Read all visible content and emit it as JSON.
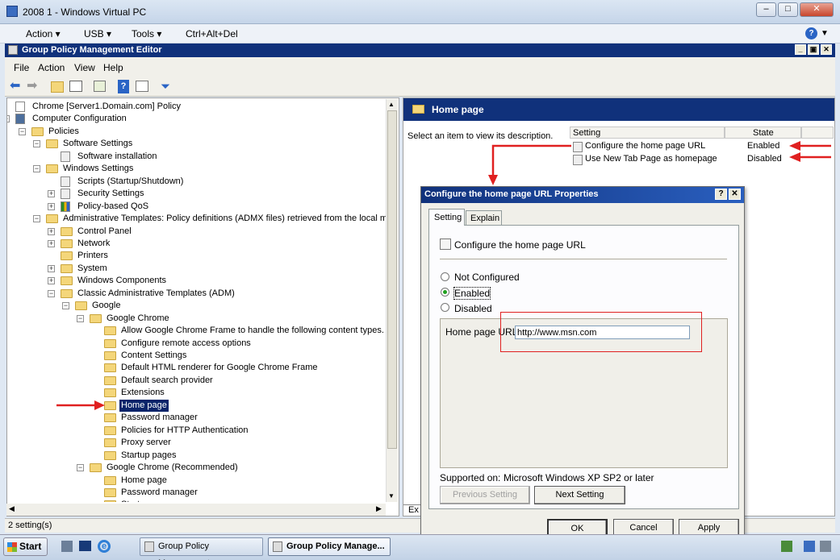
{
  "vpc": {
    "title": "2008 1 - Windows Virtual PC",
    "menu": [
      "Action ▾",
      "USB ▾",
      "Tools ▾",
      "Ctrl+Alt+Del"
    ]
  },
  "gpme": {
    "title": "Group Policy Management Editor",
    "menu": [
      "File",
      "Action",
      "View",
      "Help"
    ]
  },
  "tree": {
    "items": [
      {
        "label": "Chrome [Server1.Domain.com] Policy",
        "level": 0,
        "exp": "",
        "icon": "policy-icon"
      },
      {
        "label": "Computer Configuration",
        "level": 0,
        "exp": "−",
        "icon": "computer-icon"
      },
      {
        "label": "Policies",
        "level": 1,
        "exp": "−",
        "icon": "folder"
      },
      {
        "label": "Software Settings",
        "level": 2,
        "exp": "−",
        "icon": "folder"
      },
      {
        "label": "Software installation",
        "level": 3,
        "exp": "",
        "icon": "setting"
      },
      {
        "label": "Windows Settings",
        "level": 2,
        "exp": "−",
        "icon": "folder"
      },
      {
        "label": "Scripts (Startup/Shutdown)",
        "level": 3,
        "exp": "",
        "icon": "setting"
      },
      {
        "label": "Security Settings",
        "level": 3,
        "exp": "+",
        "icon": "setting"
      },
      {
        "label": "Policy-based QoS",
        "level": 3,
        "exp": "+",
        "icon": "chart"
      },
      {
        "label": "Administrative Templates: Policy definitions (ADMX files) retrieved from the local mac",
        "level": 2,
        "exp": "−",
        "icon": "folder"
      },
      {
        "label": "Control Panel",
        "level": 3,
        "exp": "+",
        "icon": "folder"
      },
      {
        "label": "Network",
        "level": 3,
        "exp": "+",
        "icon": "folder"
      },
      {
        "label": "Printers",
        "level": 3,
        "exp": "",
        "icon": "folder"
      },
      {
        "label": "System",
        "level": 3,
        "exp": "+",
        "icon": "folder"
      },
      {
        "label": "Windows Components",
        "level": 3,
        "exp": "+",
        "icon": "folder"
      },
      {
        "label": "Classic Administrative Templates (ADM)",
        "level": 3,
        "exp": "−",
        "icon": "folder"
      },
      {
        "label": "Google",
        "level": 4,
        "exp": "−",
        "icon": "folder"
      },
      {
        "label": "Google Chrome",
        "level": 5,
        "exp": "−",
        "icon": "folder"
      },
      {
        "label": "Allow Google Chrome Frame to handle the following content types.",
        "level": 6,
        "exp": "",
        "icon": "folder"
      },
      {
        "label": "Configure remote access options",
        "level": 6,
        "exp": "",
        "icon": "folder"
      },
      {
        "label": "Content Settings",
        "level": 6,
        "exp": "",
        "icon": "folder"
      },
      {
        "label": "Default HTML renderer for Google Chrome Frame",
        "level": 6,
        "exp": "",
        "icon": "folder"
      },
      {
        "label": "Default search provider",
        "level": 6,
        "exp": "",
        "icon": "folder"
      },
      {
        "label": "Extensions",
        "level": 6,
        "exp": "",
        "icon": "folder"
      },
      {
        "label": "Home page",
        "level": 6,
        "exp": "",
        "icon": "folder",
        "selected": true
      },
      {
        "label": "Password manager",
        "level": 6,
        "exp": "",
        "icon": "folder"
      },
      {
        "label": "Policies for HTTP Authentication",
        "level": 6,
        "exp": "",
        "icon": "folder"
      },
      {
        "label": "Proxy server",
        "level": 6,
        "exp": "",
        "icon": "folder"
      },
      {
        "label": "Startup pages",
        "level": 6,
        "exp": "",
        "icon": "folder"
      },
      {
        "label": "Google Chrome (Recommended)",
        "level": 5,
        "exp": "−",
        "icon": "folder"
      },
      {
        "label": "Home page",
        "level": 6,
        "exp": "",
        "icon": "folder"
      },
      {
        "label": "Password manager",
        "level": 6,
        "exp": "",
        "icon": "folder"
      },
      {
        "label": "Startup pages",
        "level": 6,
        "exp": "",
        "icon": "folder"
      }
    ]
  },
  "right": {
    "header": "Home page",
    "description": "Select an item to view its description.",
    "col_setting": "Setting",
    "col_state": "State",
    "rows": [
      {
        "setting": "Configure the home page URL",
        "state": "Enabled"
      },
      {
        "setting": "Use New Tab Page as homepage",
        "state": "Disabled"
      }
    ],
    "tab_ex": "Ex"
  },
  "status": "2 setting(s)",
  "dialog": {
    "title": "Configure the home page URL Properties",
    "tabs": [
      "Setting",
      "Explain"
    ],
    "policy_name": "Configure the home page URL",
    "radios": [
      "Not Configured",
      "Enabled",
      "Disabled"
    ],
    "selected_radio": "Enabled",
    "field_label": "Home page URL",
    "field_value": "http://www.msn.com",
    "supported_label": "Supported on:",
    "supported_value": "Microsoft Windows XP SP2 or later",
    "prev_btn": "Previous Setting",
    "next_btn": "Next Setting",
    "ok": "OK",
    "cancel": "Cancel",
    "apply": "Apply",
    "help_glyph": "?",
    "close_glyph": "✕"
  },
  "taskbar": {
    "start": "Start",
    "tasks": [
      "Group Policy Management",
      "Group Policy Manage..."
    ]
  },
  "colors": {
    "title_blue": "#10317b",
    "annotation_red": "#e02020",
    "selection": "#0a246a"
  }
}
